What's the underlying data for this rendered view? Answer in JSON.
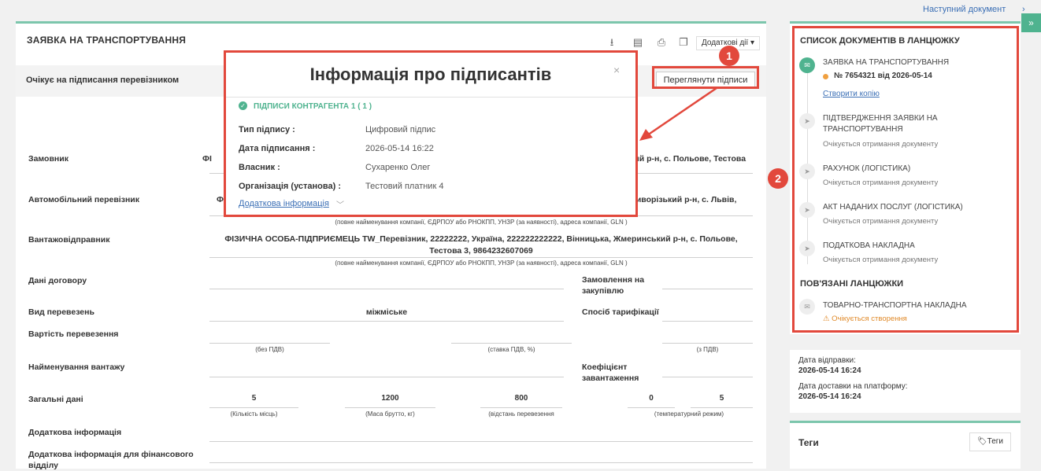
{
  "document": {
    "title": "ЗАЯВКА НА ТРАНСПОРТУВАННЯ",
    "more_actions": "Додаткові дії",
    "status": "Очікує на підписання перевізником",
    "view_signatures": "Переглянути підписи",
    "rows": {
      "customer_label": "Замовник",
      "customer_value_left": "ФІ",
      "customer_value_right": "кий р-н, с. Польове, Тестова",
      "carrier_label": "Автомобільний перевізник",
      "carrier_value_left": "Ф",
      "carrier_value_right": "Криворізький р-н, с. Львів,",
      "carrier_hint": "(повне найменування компанії, ЄДРПОУ або РНОКПП, УНЗР (за наявності), адреса компанії, GLN )",
      "shipper_label": "Вантажовідправник",
      "shipper_value": "ФІЗИЧНА ОСОБА-ПІДПРИЄМЕЦЬ TW_Перевізник, 22222222, Україна, 222222222222, Вінницька, Жмеринський р-н, с. Польове, Тестова 3, 9864232607069",
      "shipper_hint": "(повне найменування компанії, ЄДРПОУ або РНОКПП, УНЗР (за наявності), адреса компанії, GLN )",
      "contract_label": "Дані договору",
      "procurement_label": "Замовлення на закупівлю",
      "transport_type_label": "Вид перевезень",
      "transport_type_value": "міжміське",
      "tariff_label": "Спосіб тарифікації",
      "cost_label": "Вартість перевезення",
      "cost_hint_1": "(без ПДВ)",
      "cost_hint_2": "(ставка ПДВ, %)",
      "cost_hint_3": "(з ПДВ)",
      "cargo_label": "Найменування вантажу",
      "load_coef_label": "Коефіцієнт завантаження",
      "general_label": "Загальні дані",
      "general_values": [
        "5",
        "1200",
        "800",
        "0",
        "5"
      ],
      "general_hints": [
        "(Кількість місць)",
        "(Маса брутто, кг)",
        "(відстань перевезення",
        "(температурний режим)"
      ],
      "extra_info_label": "Додаткова інформація",
      "extra_fin_label": "Додаткова інформація для фінансового відділу"
    }
  },
  "modal": {
    "title": "Інформація про підписантів",
    "close": "×",
    "section": "ПІДПИСИ КОНТРАГЕНТА 1 ( 1 )",
    "fields": [
      {
        "label": "Тип підпису :",
        "value": "Цифровий підпис"
      },
      {
        "label": "Дата підписання :",
        "value": "2026-05-14 16:22"
      },
      {
        "label": "Власник :",
        "value": "Сухаренко Олег"
      },
      {
        "label": "Організація (установа) :",
        "value": "Тестовий платник 4"
      }
    ],
    "more": "Додаткова інформація"
  },
  "annotations": {
    "badge1": "1",
    "badge2": "2",
    "color": "#e2483c"
  },
  "sidebar": {
    "next_doc": "Наступний документ",
    "chain_title": "СПИСОК ДОКУМЕНТІВ В ЛАНЦЮЖКУ",
    "chain": [
      {
        "title": "ЗАЯВКА НА ТРАНСПОРТУВАННЯ",
        "number": "№ 7654321 від 2026-05-14",
        "link": "Створити копію"
      },
      {
        "title": "ПІДТВЕРДЖЕННЯ ЗАЯВКИ НА ТРАНСПОРТУВАННЯ",
        "sub": "Очікується отримання документу"
      },
      {
        "title": "РАХУНОК (ЛОГІСТИКА)",
        "sub": "Очікується отримання документу"
      },
      {
        "title": "АКТ НАДАНИХ ПОСЛУГ (ЛОГІСТИКА)",
        "sub": "Очікується отримання документу"
      },
      {
        "title": "ПОДАТКОВА НАКЛАДНА",
        "sub": "Очікується отримання документу"
      }
    ],
    "linked_title": "ПОВ'ЯЗАНІ ЛАНЦЮЖКИ",
    "linked": {
      "title": "ТОВАРНО-ТРАНСПОРТНА НАКЛАДНА",
      "sub": "Очікується створення"
    },
    "sent_label": "Дата відправки:",
    "sent_value": "2026-05-14 16:24",
    "delivered_label": "Дата доставки на платформу:",
    "delivered_value": "2026-05-14 16:24",
    "tags_title": "Теги",
    "tags_button": "Теги"
  }
}
